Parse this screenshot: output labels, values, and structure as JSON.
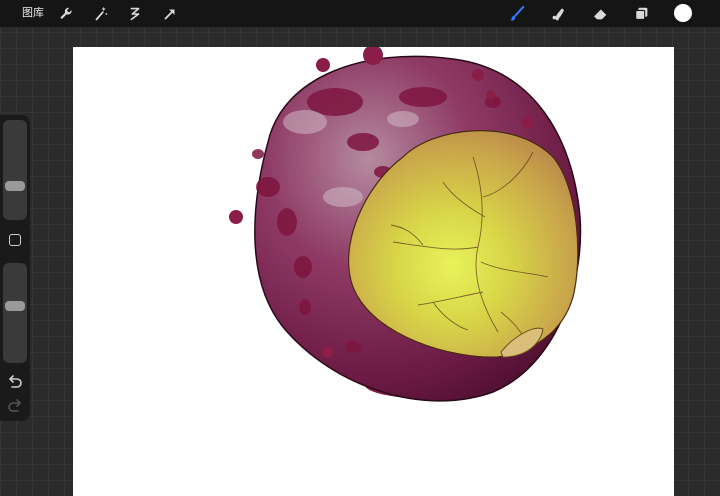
{
  "topbar": {
    "gallery_label": "图库",
    "left_tools": [
      {
        "name": "actions-wrench-icon",
        "label": "actions"
      },
      {
        "name": "adjustments-wand-icon",
        "label": "adjustments"
      },
      {
        "name": "selection-icon",
        "label": "selection"
      },
      {
        "name": "transform-arrow-icon",
        "label": "transform"
      }
    ],
    "right_tools": [
      {
        "name": "brush-icon",
        "label": "paint",
        "active": true
      },
      {
        "name": "smudge-icon",
        "label": "smudge",
        "active": false
      },
      {
        "name": "eraser-icon",
        "label": "eraser",
        "active": false
      },
      {
        "name": "layers-icon",
        "label": "layers",
        "active": false
      }
    ],
    "current_color": "#ffffff"
  },
  "sidebar": {
    "brush_size": 0.3,
    "opacity": 0.58,
    "modify_button": "square-icon",
    "undo": "undo-arrow-icon",
    "redo": "redo-arrow-icon"
  },
  "colors": {
    "accent_active": "#2f7cf6",
    "icon_default": "#d9d9d9",
    "toolbar_bg": "#151515",
    "canvas_bg": "#ffffff",
    "skin": "#7a1f4a",
    "flesh": "#d9c04a"
  }
}
